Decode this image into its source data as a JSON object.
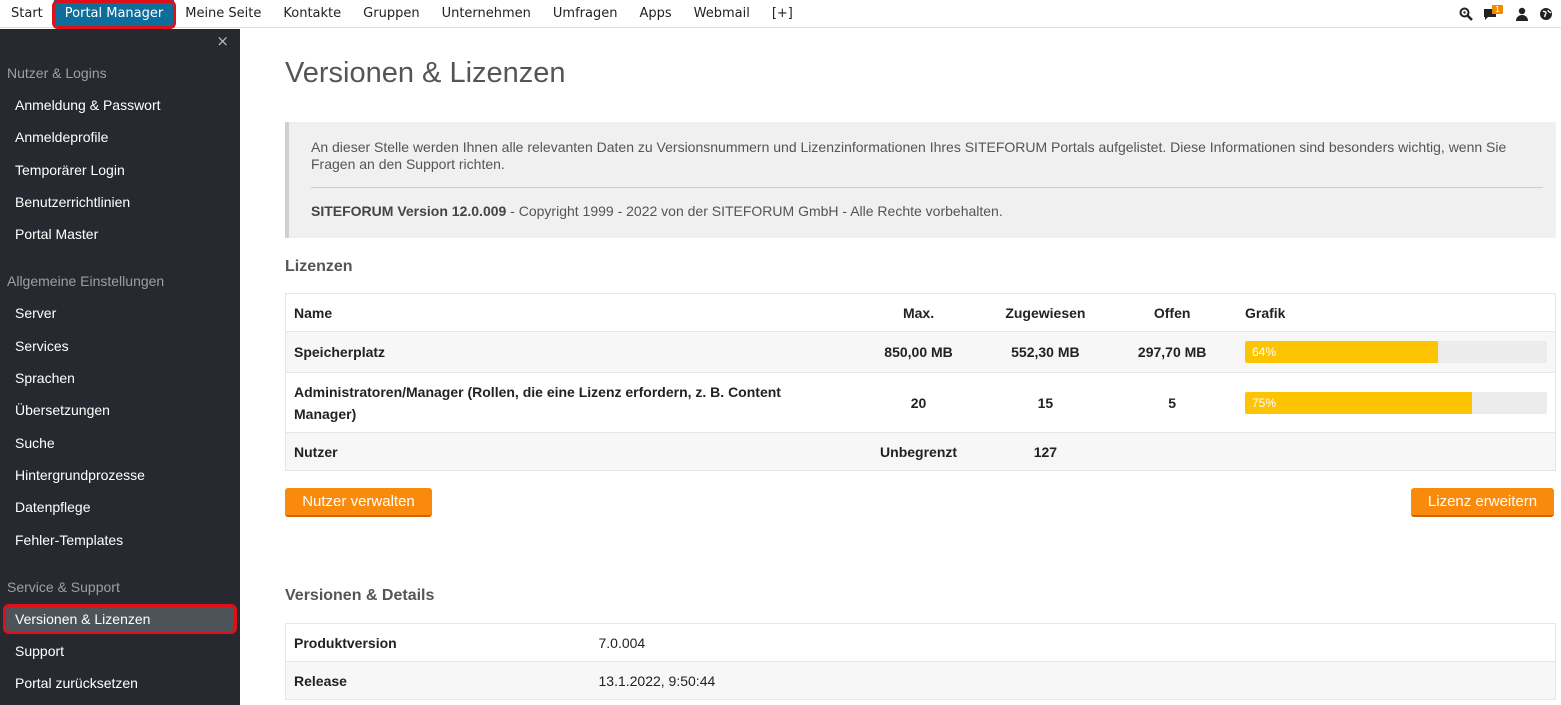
{
  "topnav": {
    "items": [
      "Start",
      "Portal Manager",
      "Meine Seite",
      "Kontakte",
      "Gruppen",
      "Unternehmen",
      "Umfragen",
      "Apps",
      "Webmail",
      "[+]"
    ],
    "active": "Portal Manager",
    "icons": [
      "search-icon",
      "chat-icon",
      "user-icon",
      "globe-icon"
    ],
    "notification_count": "1"
  },
  "sidebar": {
    "close": "×",
    "sections": [
      {
        "title": "Nutzer & Logins",
        "items": [
          "Anmeldung & Passwort",
          "Anmeldeprofile",
          "Temporärer Login",
          "Benutzerrichtlinien",
          "Portal Master"
        ]
      },
      {
        "title": "Allgemeine Einstellungen",
        "items": [
          "Server",
          "Services",
          "Sprachen",
          "Übersetzungen",
          "Suche",
          "Hintergrundprozesse",
          "Datenpflege",
          "Fehler-Templates"
        ]
      },
      {
        "title": "Service & Support",
        "items": [
          "Versionen & Lizenzen",
          "Support",
          "Portal zurücksetzen"
        ]
      }
    ],
    "active": "Versionen & Lizenzen"
  },
  "main": {
    "title": "Versionen & Lizenzen",
    "info_text": "An dieser Stelle werden Ihnen alle relevanten Daten zu Versionsnummern und Lizenzinformationen Ihres SITEFORUM Portals aufgelistet. Diese Informationen sind besonders wichtig, wenn Sie Fragen an den Support richten.",
    "version_bold": "SITEFORUM Version 12.0.009",
    "version_rest": " - Copyright 1999 - 2022 von der SITEFORUM GmbH - Alle Rechte vorbehalten.",
    "licenses_heading": "Lizenzen",
    "licenses": {
      "headers": [
        "Name",
        "Max.",
        "Zugewiesen",
        "Offen",
        "Grafik"
      ],
      "rows": [
        {
          "name": "Speicherplatz",
          "max": "850,00 MB",
          "assigned": "552,30 MB",
          "open": "297,70 MB",
          "percent": 64,
          "percent_label": "64%"
        },
        {
          "name": "Administratoren/Manager  (Rollen, die eine Lizenz erfordern, z. B. Content Manager)",
          "max": "20",
          "assigned": "15",
          "open": "5",
          "percent": 75,
          "percent_label": "75%"
        },
        {
          "name": "Nutzer",
          "max": "Unbegrenzt",
          "assigned": "127",
          "open": "",
          "percent": null,
          "percent_label": ""
        }
      ]
    },
    "btn_manage_users": "Nutzer verwalten",
    "btn_extend_license": "Lizenz erweitern",
    "details_heading": "Versionen & Details",
    "details": [
      {
        "key": "Produktversion",
        "value": "7.0.004"
      },
      {
        "key": "Release",
        "value": "13.1.2022, 9:50:44"
      }
    ],
    "colors": {
      "accent": "#0d6e9c",
      "button": "#f98a0b",
      "bar": "#fdc404",
      "sidebar": "#262a30"
    }
  }
}
